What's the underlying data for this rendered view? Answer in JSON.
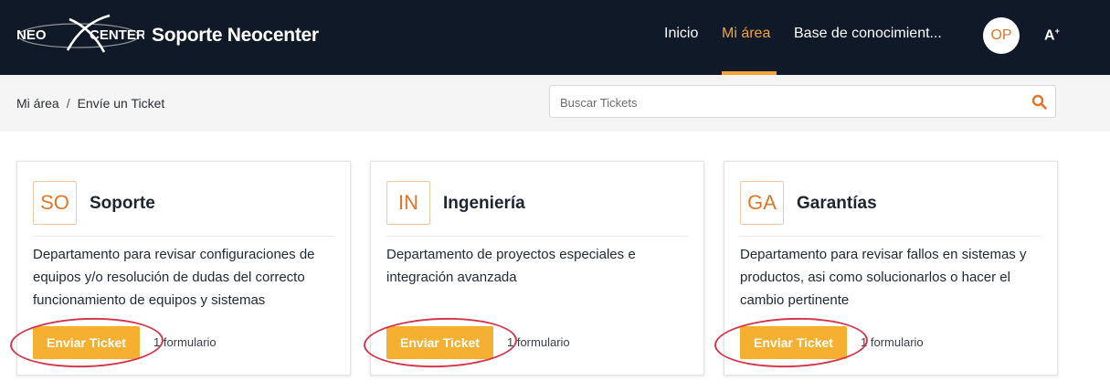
{
  "header": {
    "brand": "Soporte Neocenter",
    "nav": [
      {
        "label": "Inicio",
        "active": false
      },
      {
        "label": "Mi área",
        "active": true
      },
      {
        "label": "Base de conocimient...",
        "active": false
      }
    ],
    "avatar_initials": "OP",
    "accessibility_label": "A",
    "logo_text": "NEO CENTER"
  },
  "breadcrumb": {
    "items": [
      "Mi área",
      "Envíe un Ticket"
    ],
    "separator": "/"
  },
  "search": {
    "placeholder": "Buscar Tickets",
    "value": ""
  },
  "cards": [
    {
      "badge": "SO",
      "title": "Soporte",
      "description": "Departamento para revisar configuraciones de equipos y/o resolución de dudas del correcto funcionamiento de equipos y sistemas",
      "button_label": "Enviar Ticket",
      "forms_count": "1 formulario"
    },
    {
      "badge": "IN",
      "title": "Ingeniería",
      "description": "Departamento de proyectos especiales e integración avanzada",
      "button_label": "Enviar Ticket",
      "forms_count": "1 formulario"
    },
    {
      "badge": "GA",
      "title": "Garantías",
      "description": "Departamento para revisar fallos en sistemas y productos, asi como solucionarlos o hacer el cambio pertinente",
      "button_label": "Enviar Ticket",
      "forms_count": "1 formulario"
    }
  ],
  "colors": {
    "header_bg": "#0f1927",
    "accent": "#f2a33a",
    "button": "#f5b031",
    "badge_text": "#e0762a",
    "annotation": "#d4364d"
  }
}
